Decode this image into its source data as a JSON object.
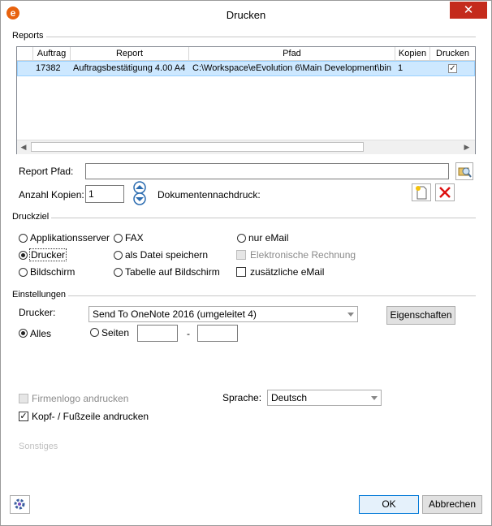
{
  "window": {
    "title": "Drucken",
    "close_glyph": "✕",
    "app_icon_letter": "e"
  },
  "reports": {
    "group_label": "Reports",
    "columns": [
      "Auftrag",
      "Report",
      "Pfad",
      "Kopien",
      "Drucken"
    ],
    "rows": [
      {
        "auftrag": "17382",
        "report": "Auftragsbestätigung 4.00 A4",
        "pfad": "C:\\Workspace\\eEvolution 6\\Main Development\\bin",
        "kopien": "1",
        "drucken": true
      }
    ],
    "scroll_left_glyph": "◀",
    "scroll_right_glyph": "▶"
  },
  "report_pfad": {
    "label": "Report Pfad:",
    "value": ""
  },
  "anzahl_kopien": {
    "label": "Anzahl Kopien:",
    "value": "1"
  },
  "dokumentennachdruck": {
    "label": "Dokumentennachdruck:"
  },
  "druckziel": {
    "group_label": "Druckziel",
    "options": {
      "applikationsserver": "Applikationsserver",
      "drucker": "Drucker",
      "bildschirm": "Bildschirm",
      "fax": "FAX",
      "als_datei": "als Datei speichern",
      "tabelle": "Tabelle auf Bildschirm",
      "nur_email": "nur eMail"
    },
    "selected": "Drucker",
    "elektronische_rechnung": "Elektronische Rechnung",
    "zusaetzliche_email": "zusätzliche eMail"
  },
  "einstellungen": {
    "group_label": "Einstellungen",
    "drucker_label": "Drucker:",
    "drucker_value": "Send To OneNote 2016 (umgeleitet 4)",
    "eigenschaften": "Eigenschaften",
    "alles": "Alles",
    "seiten": "Seiten",
    "seiten_from": "",
    "seiten_to": "",
    "dash": "-"
  },
  "firmenlogo": {
    "label": "Firmenlogo andrucken",
    "checked": false,
    "enabled": false
  },
  "kopfzeile": {
    "label": "Kopf- / Fußzeile andrucken",
    "checked": true
  },
  "sprache": {
    "label": "Sprache:",
    "value": "Deutsch"
  },
  "sonstiges": {
    "label": "Sonstiges"
  },
  "buttons": {
    "ok": "OK",
    "abbrechen": "Abbrechen"
  },
  "colors": {
    "close": "#c42b1c",
    "selection": "#cde8ff",
    "accent": "#0078d7",
    "icon_orange": "#e8620e"
  },
  "icons": [
    "app-logo-icon",
    "close-icon",
    "browse-folder-icon",
    "spin-up-icon",
    "spin-down-icon",
    "new-document-icon",
    "delete-icon",
    "settings-gear-icon"
  ]
}
